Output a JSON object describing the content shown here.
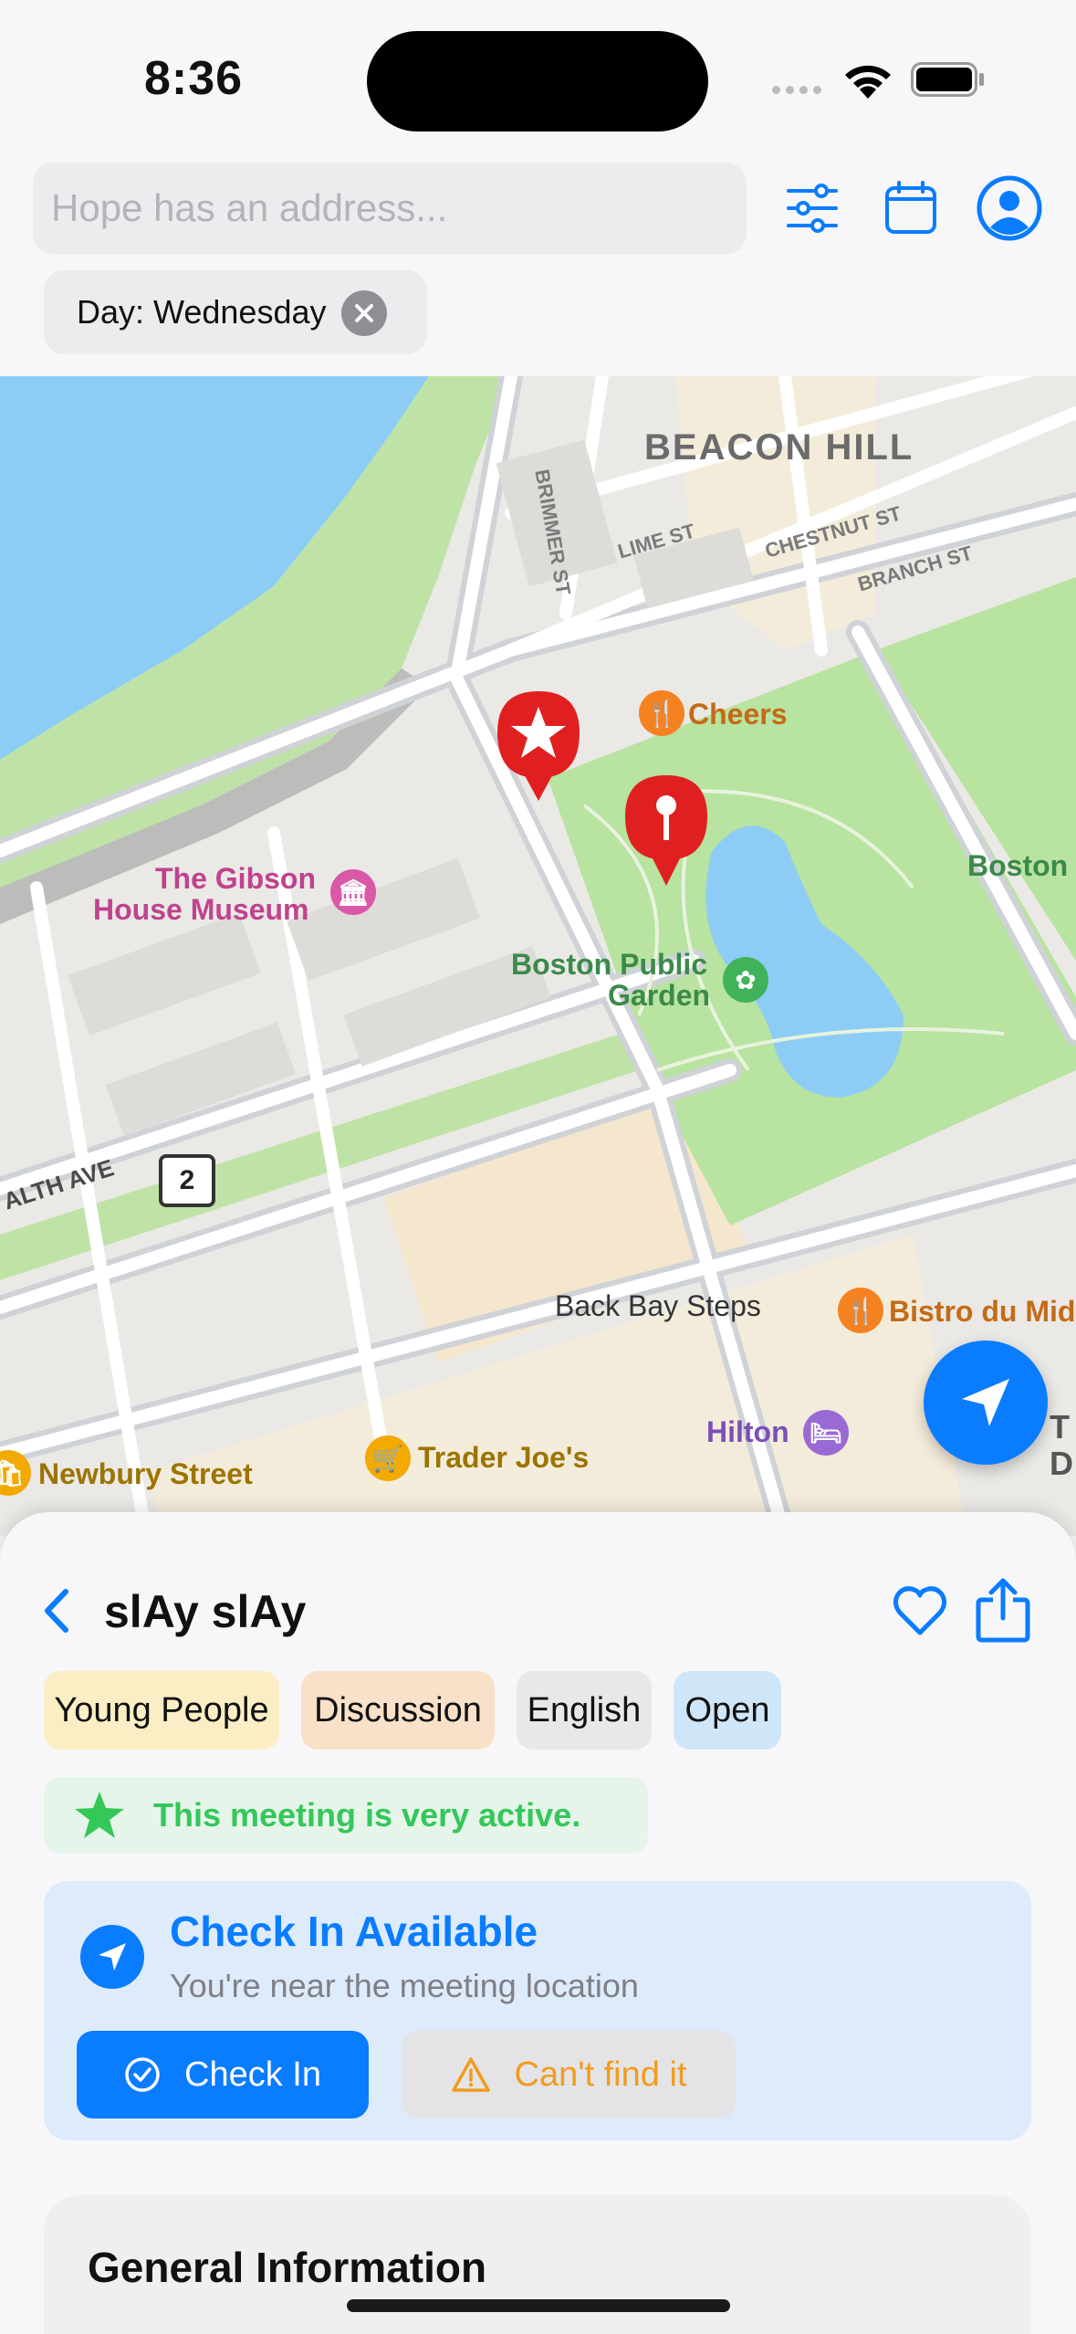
{
  "status_bar": {
    "time": "8:36"
  },
  "search": {
    "placeholder": "Hope has an address..."
  },
  "header_icons": [
    "sliders-icon",
    "calendar-icon",
    "person-circle-icon"
  ],
  "filter_chip": {
    "label": "Day: Wednesday"
  },
  "map": {
    "labels": {
      "beacon_hill": "BEACON HILL",
      "brimmer_st": "BRIMMER ST",
      "lime_st": "LIME ST",
      "chestnut_st": "CHESTNUT ST",
      "branch_st": "BRANCH ST",
      "cheers": "Cheers",
      "gibson_line1": "The Gibson",
      "gibson_line2": "House Museum",
      "public_garden_line1": "Boston Public",
      "public_garden_line2": "Garden",
      "boston": "Boston",
      "commonwealth_ave": "ALTH AVE",
      "route_shield": "2",
      "back_bay_steps": "Back Bay Steps",
      "bistro": "Bistro du Mid",
      "hilton": "Hilton",
      "trader_joes": "Trader Joe's",
      "newbury_street": "Newbury Street",
      "edge_t": "T",
      "edge_d": "D"
    }
  },
  "meeting": {
    "title": "slAy slAy",
    "tags": [
      {
        "label": "Young People",
        "color": "#fbeec5"
      },
      {
        "label": "Discussion",
        "color": "#f8e1c8"
      },
      {
        "label": "English",
        "color": "#e8e8ea"
      },
      {
        "label": "Open",
        "color": "#cfe6f8"
      }
    ],
    "activity": "This meeting is very active."
  },
  "checkin": {
    "title": "Check In Available",
    "subtitle": "You're near the meeting location",
    "check_in_label": "Check In",
    "cant_find_label": "Can't find it"
  },
  "general_information": {
    "title": "General Information"
  },
  "colors": {
    "accent": "#0a7cff",
    "active_green": "#34c759",
    "warning_orange": "#f29b1c",
    "park_green": "#b8e3a0",
    "water_blue": "#8dcdf5",
    "pin_red": "#e02020"
  }
}
